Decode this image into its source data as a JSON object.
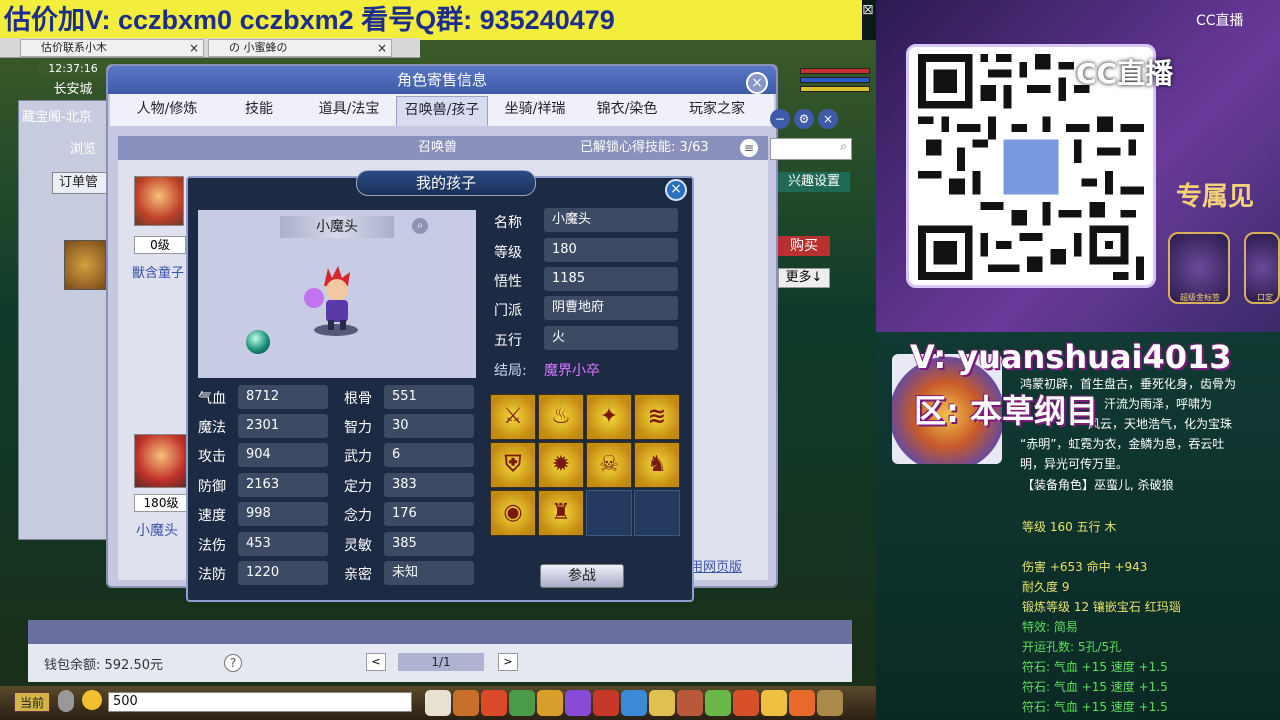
{
  "banner": {
    "text": "估价加V:  cczbxm0   cczbxm2   看号Q群: 935240479",
    "close": "⊠"
  },
  "browser_tabs": [
    {
      "label": "估价联系小木",
      "close": "×"
    },
    {
      "label": "の 小蜜蜂の",
      "close": "×"
    }
  ],
  "game": {
    "clock": "12:37:16",
    "city": "长安城"
  },
  "back_window": {
    "title": "藏宝阁-北京",
    "browse": "浏览",
    "order": "订单管"
  },
  "dialog": {
    "title": "角色寄售信息",
    "close": "×",
    "tabs": [
      "人物/修炼",
      "技能",
      "道具/法宝",
      "召唤兽/孩子",
      "坐骑/祥瑞",
      "锦衣/染色",
      "玩家之家"
    ],
    "active_tab": "召唤兽/孩子",
    "section_title": "召唤兽",
    "unlock_text": "已解锁心得技能: 3/63",
    "menu_icon": "≡"
  },
  "cards": [
    {
      "level": "0级",
      "name": "獸含童子"
    },
    {
      "level": "180级",
      "name": "小魔头"
    }
  ],
  "side_buttons": {
    "interest": "兴趣设置",
    "buy": "购买",
    "more": "更多↓",
    "link": "用网页版"
  },
  "child": {
    "title": "我的孩子",
    "close": "×",
    "pet_name": "小魔头",
    "info": [
      {
        "label": "名称",
        "value": "小魔头"
      },
      {
        "label": "等级",
        "value": "180"
      },
      {
        "label": "悟性",
        "value": "1185"
      },
      {
        "label": "门派",
        "value": "阴曹地府"
      },
      {
        "label": "五行",
        "value": "火"
      }
    ],
    "ending_label": "结局:",
    "ending_value": "魔界小卒",
    "stats_left": [
      {
        "label": "气血",
        "value": "8712"
      },
      {
        "label": "魔法",
        "value": "2301"
      },
      {
        "label": "攻击",
        "value": "904"
      },
      {
        "label": "防御",
        "value": "2163"
      },
      {
        "label": "速度",
        "value": "998"
      },
      {
        "label": "法伤",
        "value": "453"
      },
      {
        "label": "法防",
        "value": "1220"
      }
    ],
    "stats_right": [
      {
        "label": "根骨",
        "value": "551"
      },
      {
        "label": "智力",
        "value": "30"
      },
      {
        "label": "武力",
        "value": "6"
      },
      {
        "label": "定力",
        "value": "383"
      },
      {
        "label": "念力",
        "value": "176"
      },
      {
        "label": "灵敏",
        "value": "385"
      },
      {
        "label": "亲密",
        "value": "未知"
      }
    ],
    "fight_button": "参战",
    "skills_filled": 10,
    "skills_total": 12
  },
  "footer": {
    "wallet": "钱包余额: 592.50元",
    "help": "?",
    "prev": "<",
    "page": "1/1",
    "next": ">"
  },
  "chat": {
    "channel": "当前",
    "input": "500"
  },
  "right": {
    "cc_logo": "CC直播",
    "watermark": "CC直播",
    "exclusive": "专属见",
    "icon_caption_1": "超级金标签",
    "icon_caption_2": "口定",
    "v_line": "V: yuanshuai4013",
    "area_line": "区: 本草纲目",
    "desc_lines": [
      "鸿蒙初辟，首生盘古，垂死化身，齿骨为",
      "汗流为雨泽，呼啸为",
      "风云，天地浩气，化为宝珠",
      "“赤明”，虹霓为衣，金鳞为息，吞云吐",
      "明，异光可传万里。"
    ],
    "equip_role": "【装备角色】巫蛮儿, 杀破狼",
    "level_line": "等级 160  五行 木",
    "damage_line": "伤害 +653  命中 +943",
    "durability": "耐久度 9",
    "forge_line": "锻炼等级 12  镶嵌宝石 红玛瑙",
    "effect": "特效: 简易",
    "holes": "开运孔数: 5孔/5孔",
    "runes": [
      "符石: 气血 +15  速度 +1.5",
      "符石: 气血 +15  速度 +1.5",
      "符石: 气血 +15  速度 +1.5"
    ]
  }
}
